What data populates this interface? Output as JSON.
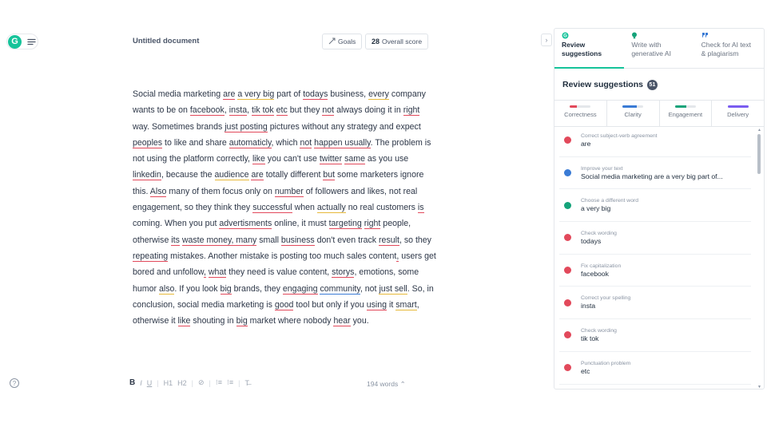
{
  "document": {
    "title": "Untitled document",
    "goals_label": "Goals",
    "score_value": "28",
    "score_label": "Overall score",
    "word_count": "194 words",
    "text_segments": [
      {
        "t": "Social media marketing "
      },
      {
        "t": "are",
        "c": "e"
      },
      {
        "t": " "
      },
      {
        "t": "a very big",
        "c": "w"
      },
      {
        "t": " part of "
      },
      {
        "t": "todays",
        "c": "e"
      },
      {
        "t": " business, "
      },
      {
        "t": "every",
        "c": "w"
      },
      {
        "t": " company wants to be on "
      },
      {
        "t": "facebook",
        "c": "e"
      },
      {
        "t": ", "
      },
      {
        "t": "insta",
        "c": "e"
      },
      {
        "t": ", "
      },
      {
        "t": "tik tok",
        "c": "e"
      },
      {
        "t": " "
      },
      {
        "t": "etc",
        "c": "e"
      },
      {
        "t": " but they "
      },
      {
        "t": "not",
        "c": "e"
      },
      {
        "t": " always doing it in "
      },
      {
        "t": "right",
        "c": "e"
      },
      {
        "t": " way. Sometimes brands "
      },
      {
        "t": "just posting",
        "c": "e"
      },
      {
        "t": " pictures without any strategy and expect "
      },
      {
        "t": "peoples",
        "c": "e"
      },
      {
        "t": " to like and share "
      },
      {
        "t": "automaticly",
        "c": "e"
      },
      {
        "t": ", which "
      },
      {
        "t": "not",
        "c": "e"
      },
      {
        "t": " "
      },
      {
        "t": "happen usually",
        "c": "e"
      },
      {
        "t": ". The problem is not using the platform correctly, "
      },
      {
        "t": "like",
        "c": "e"
      },
      {
        "t": " you can't use "
      },
      {
        "t": "twitter",
        "c": "e"
      },
      {
        "t": " "
      },
      {
        "t": "same",
        "c": "e"
      },
      {
        "t": " as you use "
      },
      {
        "t": "linkedin",
        "c": "e"
      },
      {
        "t": ", because the "
      },
      {
        "t": "audience",
        "c": "w"
      },
      {
        "t": " "
      },
      {
        "t": "are",
        "c": "e"
      },
      {
        "t": " totally different "
      },
      {
        "t": "but",
        "c": "e"
      },
      {
        "t": " some marketers ignore this. "
      },
      {
        "t": "Also",
        "c": "e"
      },
      {
        "t": " many of them focus only on "
      },
      {
        "t": "number",
        "c": "e"
      },
      {
        "t": " of followers and likes, not real engagement, so they think they "
      },
      {
        "t": "successful",
        "c": "e"
      },
      {
        "t": " when "
      },
      {
        "t": "actually",
        "c": "w"
      },
      {
        "t": " no real customers "
      },
      {
        "t": "is",
        "c": "e"
      },
      {
        "t": " coming. When you put "
      },
      {
        "t": "advertisments",
        "c": "e"
      },
      {
        "t": " online, it must "
      },
      {
        "t": "targeting",
        "c": "e"
      },
      {
        "t": " "
      },
      {
        "t": "right",
        "c": "e"
      },
      {
        "t": " people, otherwise "
      },
      {
        "t": "its",
        "c": "e"
      },
      {
        "t": " "
      },
      {
        "t": "waste money, many",
        "c": "e"
      },
      {
        "t": " small "
      },
      {
        "t": "business",
        "c": "e"
      },
      {
        "t": " don't even track "
      },
      {
        "t": "result",
        "c": "e"
      },
      {
        "t": ", so they "
      },
      {
        "t": "repeating",
        "c": "e"
      },
      {
        "t": " mistakes. Another mistake is posting too much sales content"
      },
      {
        "t": ",",
        "c": "e"
      },
      {
        "t": " users get bored and unfollow"
      },
      {
        "t": ",",
        "c": "e"
      },
      {
        "t": " "
      },
      {
        "t": "what",
        "c": "e"
      },
      {
        "t": " they need is value content, "
      },
      {
        "t": "storys",
        "c": "e"
      },
      {
        "t": ", emotions, some humor "
      },
      {
        "t": "also",
        "c": "w"
      },
      {
        "t": ". If you look "
      },
      {
        "t": "big",
        "c": "e"
      },
      {
        "t": " brands, they "
      },
      {
        "t": "engaging",
        "c": "e"
      },
      {
        "t": " "
      },
      {
        "t": "community",
        "c": "b"
      },
      {
        "t": ", not "
      },
      {
        "t": "just sell",
        "c": "w"
      },
      {
        "t": ". So, in conclusion, social media marketing is "
      },
      {
        "t": "good",
        "c": "e"
      },
      {
        "t": " tool but only if you "
      },
      {
        "t": "using",
        "c": "e"
      },
      {
        "t": " it "
      },
      {
        "t": "smart",
        "c": "w"
      },
      {
        "t": ", otherwise it "
      },
      {
        "t": "like",
        "c": "e"
      },
      {
        "t": " shouting in "
      },
      {
        "t": "big",
        "c": "e"
      },
      {
        "t": " market where nobody "
      },
      {
        "t": "hear",
        "c": "e"
      },
      {
        "t": " you."
      }
    ]
  },
  "toolbar": {
    "bold": "B",
    "italic": "I",
    "underline": "U",
    "h1": "H1",
    "h2": "H2",
    "link": "⊘",
    "ordered_list": "⁝≡",
    "unordered_list": "⁝≡",
    "clear": "T̶"
  },
  "panel": {
    "tabs": [
      {
        "label": "Review suggestions",
        "icon": "grammarly-icon",
        "active": true
      },
      {
        "label": "Write with generative AI",
        "icon": "bulb-icon",
        "active": false
      },
      {
        "label": "Check for AI text & plagiarism",
        "icon": "quote-icon",
        "active": false
      }
    ],
    "heading": "Review suggestions",
    "count": "51",
    "categories": [
      {
        "label": "Correctness",
        "color": "#e2495b",
        "level": 0.35
      },
      {
        "label": "Clarity",
        "color": "#3a7bd5",
        "level": 0.7
      },
      {
        "label": "Engagement",
        "color": "#15a37a",
        "level": 0.55
      },
      {
        "label": "Delivery",
        "color": "#7a5cf0",
        "level": 1.0
      }
    ],
    "suggestions": [
      {
        "label": "Correct subject-verb agreement",
        "value": "are",
        "color": "#e2495b"
      },
      {
        "label": "Improve your text",
        "value": "Social media marketing are a very big part of...",
        "color": "#3a7bd5"
      },
      {
        "label": "Choose a different word",
        "value": "a very big",
        "color": "#15a37a"
      },
      {
        "label": "Check wording",
        "value": "todays",
        "color": "#e2495b"
      },
      {
        "label": "Fix capitalization",
        "value": "facebook",
        "color": "#e2495b"
      },
      {
        "label": "Correct your spelling",
        "value": "insta",
        "color": "#e2495b"
      },
      {
        "label": "Check wording",
        "value": "tik tok",
        "color": "#e2495b"
      },
      {
        "label": "Punctuation problem",
        "value": "etc",
        "color": "#e2495b"
      }
    ]
  }
}
